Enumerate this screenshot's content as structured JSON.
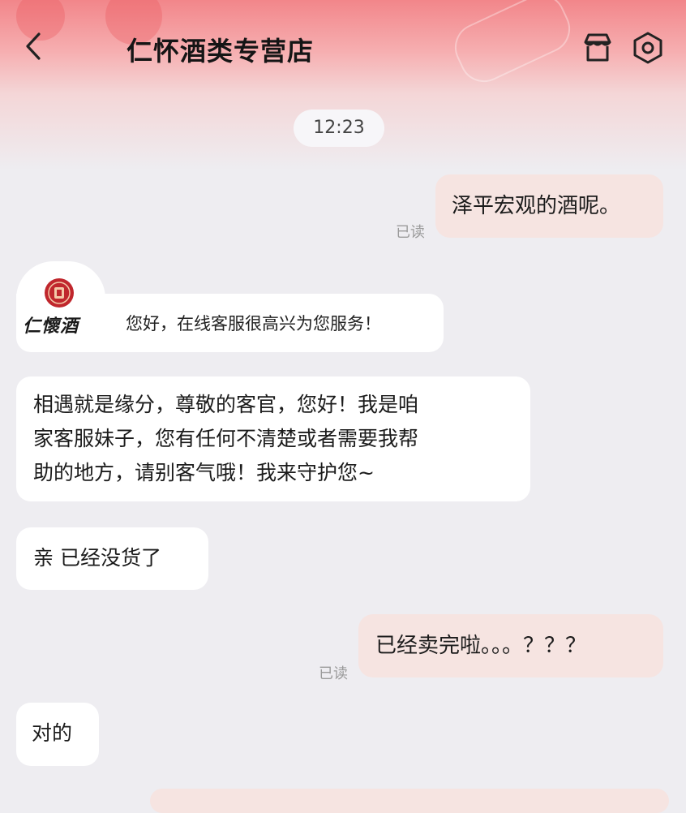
{
  "header": {
    "title": "仁怀酒类专营店",
    "back_icon": "chevron-left-icon",
    "shop_icon": "storefront-icon",
    "settings_icon": "hexagon-settings-icon"
  },
  "chat": {
    "timestamp": "12:23",
    "read_status": "已读",
    "messages": [
      {
        "side": "out",
        "text": "泽平宏观的酒呢。",
        "status": "已读"
      },
      {
        "side": "in",
        "type": "welcome",
        "brand_logo_text": "仁懷酒",
        "text": "您好，在线客服很高兴为您服务！"
      },
      {
        "side": "in",
        "lines": [
          "相遇就是缘分，尊敬的客官，您好！我是咱",
          "家客服妹子，您有任何不清楚或者需要我帮",
          "助的地方，请别客气哦！我来守护您~"
        ]
      },
      {
        "side": "in",
        "text": "亲 已经没货了"
      },
      {
        "side": "out",
        "text": "已经卖完啦。。。？？？",
        "status": "已读"
      },
      {
        "side": "in",
        "text": "对的"
      }
    ]
  },
  "colors": {
    "header_gradient_top": "#f2868a",
    "page_background": "#eeedf1",
    "outgoing_bubble": "#f6e4e1",
    "incoming_bubble": "#ffffff"
  }
}
